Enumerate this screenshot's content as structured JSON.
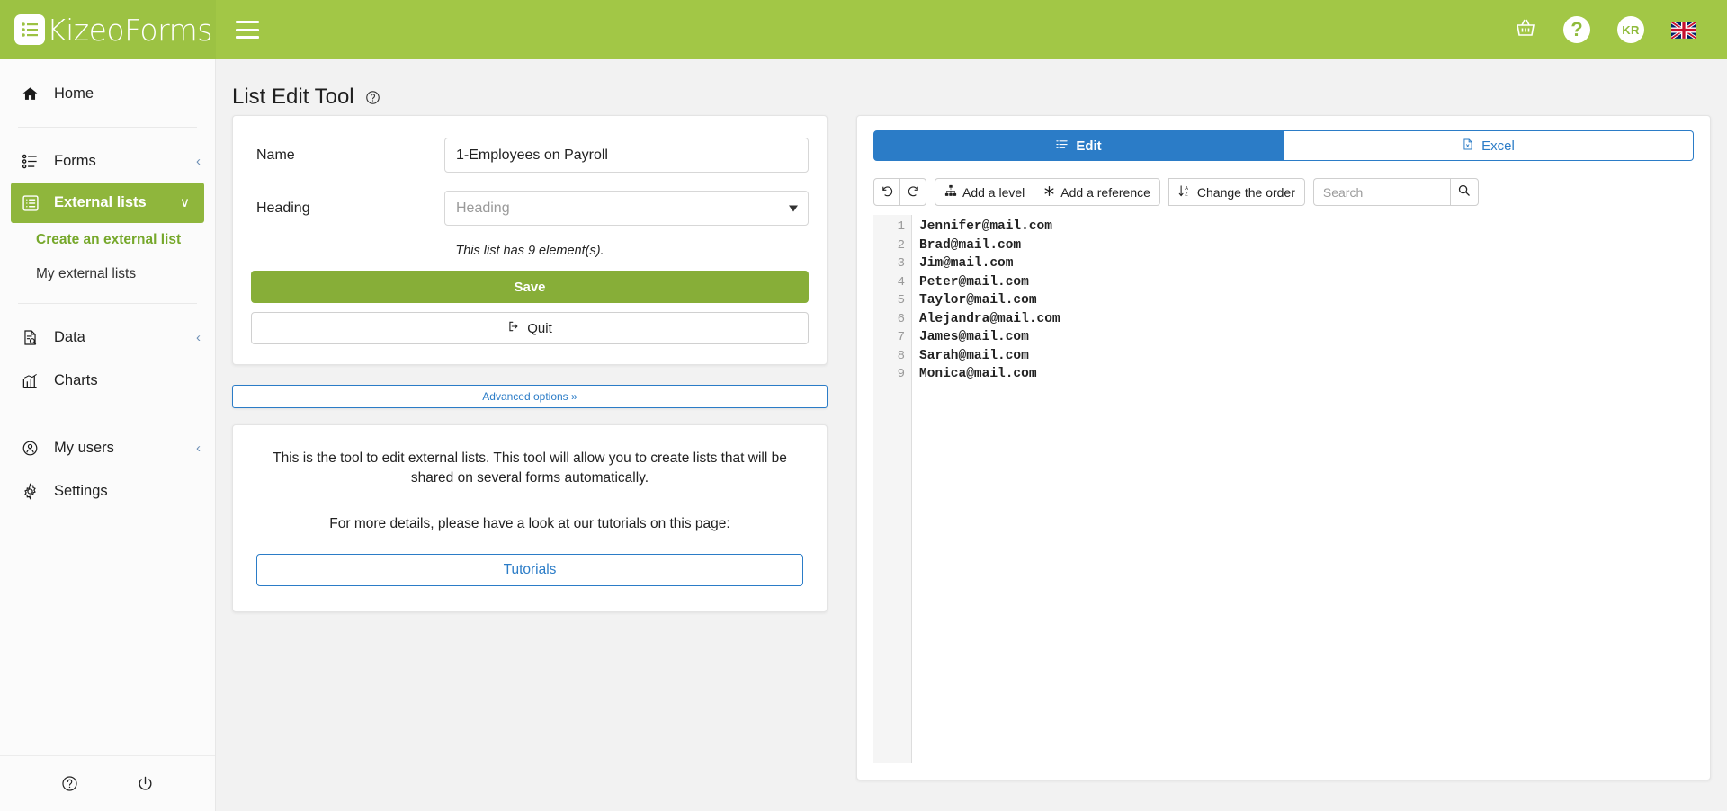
{
  "header": {
    "brand": "KizeoForms",
    "logo_icon": "list-logo-icon",
    "menu_icon": "hamburger-menu-icon",
    "grid_icon": "apps-grid-icon",
    "basket_icon": "shopping-basket-icon",
    "help_label": "?",
    "avatar_initials": "KR",
    "flag_icon": "uk-flag-icon"
  },
  "sidebar": {
    "items": [
      {
        "label": "Home",
        "icon": "home-icon",
        "caret": "",
        "active": false
      },
      {
        "label": "Forms",
        "icon": "forms-list-icon",
        "caret": "‹",
        "active": false
      },
      {
        "label": "External lists",
        "icon": "external-lists-icon",
        "caret": "∨",
        "active": true
      },
      {
        "label": "Data",
        "icon": "data-search-icon",
        "caret": "‹",
        "active": false
      },
      {
        "label": "Charts",
        "icon": "charts-bar-icon",
        "caret": "",
        "active": false
      },
      {
        "label": "My users",
        "icon": "user-circle-icon",
        "caret": "‹",
        "active": false
      },
      {
        "label": "Settings",
        "icon": "gear-icon",
        "caret": "",
        "active": false
      }
    ],
    "sub_items": [
      {
        "label": "Create an external list",
        "highlighted": true
      },
      {
        "label": "My external lists",
        "highlighted": false
      }
    ],
    "footer": {
      "help_icon": "help-circle-icon",
      "power_icon": "power-off-icon"
    }
  },
  "page": {
    "title": "List Edit Tool",
    "help_icon": "help-circle-icon"
  },
  "form": {
    "name_label": "Name",
    "name_value": "1-Employees on Payroll",
    "name_placeholder": "Name",
    "heading_label": "Heading",
    "heading_selected": "Heading",
    "heading_options": [
      "Heading"
    ],
    "element_count_note": "This list has 9 element(s).",
    "save_label": "Save",
    "quit_label": "Quit",
    "quit_icon": "exit-icon",
    "advanced_options_label": "Advanced options »"
  },
  "info": {
    "paragraph1": "This is the tool to edit external lists. This tool will allow you to create lists that will be shared on several forms automatically.",
    "paragraph2": "For more details, please have a look at our tutorials on this page:",
    "tutorials_label": "Tutorials"
  },
  "editor": {
    "tabs": [
      {
        "label": "Edit",
        "icon": "edit-list-icon",
        "active": true
      },
      {
        "label": "Excel",
        "icon": "excel-file-icon",
        "active": false
      }
    ],
    "toolbar": {
      "undo_icon": "undo-icon",
      "redo_icon": "redo-icon",
      "add_level_label": "Add a level",
      "add_level_icon": "sitemap-icon",
      "add_reference_label": "Add a reference",
      "add_reference_icon": "asterisk-icon",
      "change_order_label": "Change the order",
      "change_order_icon": "sort-alpha-down-icon",
      "search_placeholder": "Search",
      "search_value": "",
      "search_icon": "search-icon"
    },
    "line_numbers": [
      "1",
      "2",
      "3",
      "4",
      "5",
      "6",
      "7",
      "8",
      "9"
    ],
    "lines": [
      "Jennifer@mail.com",
      "Brad@mail.com",
      "Jim@mail.com",
      "Peter@mail.com",
      "Taylor@mail.com",
      "Alejandra@mail.com",
      "James@mail.com",
      "Sarah@mail.com",
      "Monica@mail.com"
    ]
  },
  "colors": {
    "header_green": "#a2c746",
    "logo_green": "#9cc243",
    "active_green": "#8fb63c",
    "save_green": "#87ae38",
    "link_green": "#76a82b",
    "accent_blue": "#2b7cc7",
    "page_bg": "#f2f2f2"
  }
}
